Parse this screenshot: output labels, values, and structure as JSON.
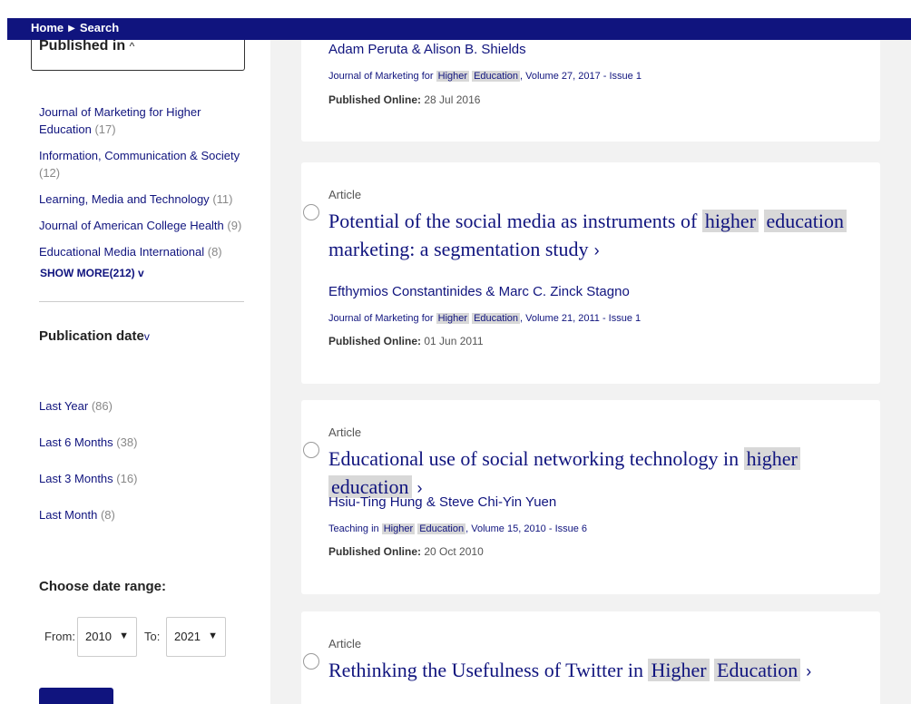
{
  "breadcrumb": {
    "home": "Home",
    "separator": "▶",
    "current": "Search"
  },
  "sidebar": {
    "published_in": {
      "title": "Published in",
      "chevron": "^"
    },
    "journals": [
      {
        "name": "Journal of Marketing for Higher Education",
        "count": "(17)"
      },
      {
        "name": "Information, Communication & Society",
        "count": "(12)"
      },
      {
        "name": "Learning, Media and Technology",
        "count": "(11)"
      },
      {
        "name": "Journal of American College Health",
        "count": "(9)"
      },
      {
        "name": "Educational Media International",
        "count": "(8)"
      }
    ],
    "show_more": "SHOW MORE(212)",
    "show_more_chevron": "v",
    "publication_date": {
      "title": "Publication date",
      "chevron": "v"
    },
    "date_filters": [
      {
        "label": "Last Year",
        "count": "(86)"
      },
      {
        "label": "Last 6 Months",
        "count": "(38)"
      },
      {
        "label": "Last 3 Months",
        "count": "(16)"
      },
      {
        "label": "Last Month",
        "count": "(8)"
      }
    ],
    "date_range": {
      "title": "Choose date range:",
      "from_label": "From:",
      "from_value": "2010",
      "to_label": "To:",
      "to_value": "2021"
    }
  },
  "results": [
    {
      "authors": "Adam Peruta & Alison B. Shields",
      "journal_pre": "Journal of Marketing for ",
      "journal_hl1": "Higher",
      "journal_hl2": "Education",
      "journal_post": ", Volume 27, 2017 - Issue 1",
      "published_label": "Published Online:",
      "published_date": "28 Jul 2016"
    },
    {
      "type": "Article",
      "title_pre": "Potential of the social media as instruments of ",
      "title_hl1": "higher",
      "title_hl2": "education",
      "title_post": " marketing: a segmentation study",
      "arrow": "›",
      "authors": "Efthymios Constantinides & Marc C. Zinck Stagno",
      "journal_pre": "Journal of Marketing for ",
      "journal_hl1": "Higher",
      "journal_hl2": "Education",
      "journal_post": ", Volume 21, 2011 - Issue 1",
      "published_label": "Published Online:",
      "published_date": "01 Jun 2011"
    },
    {
      "type": "Article",
      "title_pre": "Educational use of social networking technology in ",
      "title_hl1": "higher",
      "title_hl2": "education",
      "title_post": "",
      "arrow": "›",
      "authors": "Hsiu-Ting Hung & Steve Chi-Yin Yuen",
      "journal_pre": "Teaching in ",
      "journal_hl1": "Higher",
      "journal_hl2": "Education",
      "journal_post": ", Volume 15, 2010 - Issue 6",
      "published_label": "Published Online:",
      "published_date": "20 Oct 2010"
    },
    {
      "type": "Article",
      "title_pre": "Rethinking the Usefulness of Twitter in ",
      "title_hl1": "Higher",
      "title_hl2": "Education",
      "title_post": "",
      "arrow": "›"
    }
  ],
  "colors": {
    "brand": "#10147e",
    "highlight": "#d8d8d8",
    "background": "#f2f2f2"
  }
}
